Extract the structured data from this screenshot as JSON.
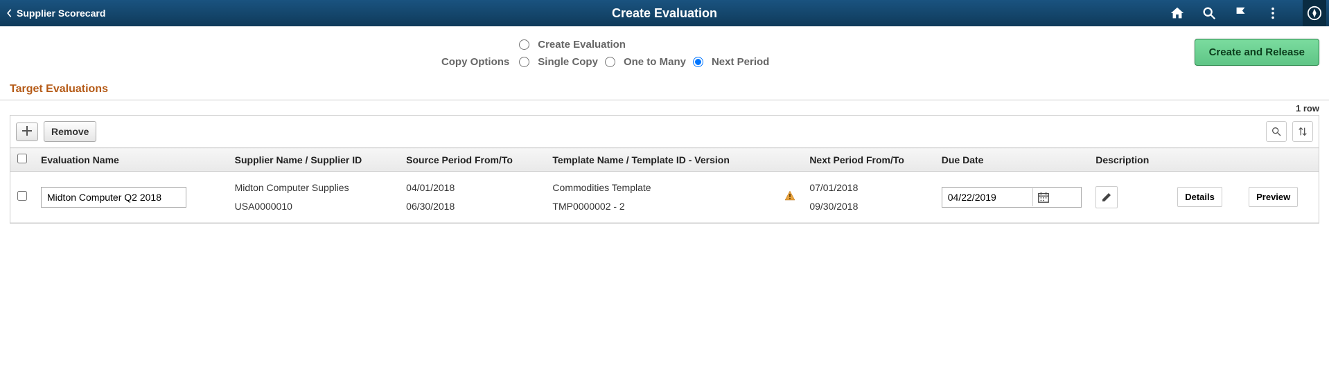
{
  "header": {
    "back_label": "Supplier Scorecard",
    "title": "Create Evaluation"
  },
  "actions": {
    "create_release": "Create and Release"
  },
  "options": {
    "create_eval_label": "Create Evaluation",
    "copy_options_label": "Copy Options",
    "single_copy": "Single Copy",
    "one_to_many": "One to Many",
    "next_period": "Next Period"
  },
  "section": {
    "title": "Target Evaluations",
    "row_count": "1 row"
  },
  "toolbar": {
    "remove_label": "Remove"
  },
  "columns": {
    "eval_name": "Evaluation Name",
    "supplier": "Supplier Name / Supplier ID",
    "source_period": "Source Period From/To",
    "template": "Template Name / Template ID - Version",
    "next_period": "Next Period From/To",
    "due_date": "Due Date",
    "description": "Description"
  },
  "rows": [
    {
      "eval_name": "Midton Computer Q2 2018",
      "supplier_name": "Midton Computer Supplies",
      "supplier_id": "USA0000010",
      "source_from": "04/01/2018",
      "source_to": "06/30/2018",
      "template_name": "Commodities Template",
      "template_id_version": "TMP0000002  - 2",
      "next_from": "07/01/2018",
      "next_to": "09/30/2018",
      "due_date": "04/22/2019",
      "details_label": "Details",
      "preview_label": "Preview"
    }
  ]
}
